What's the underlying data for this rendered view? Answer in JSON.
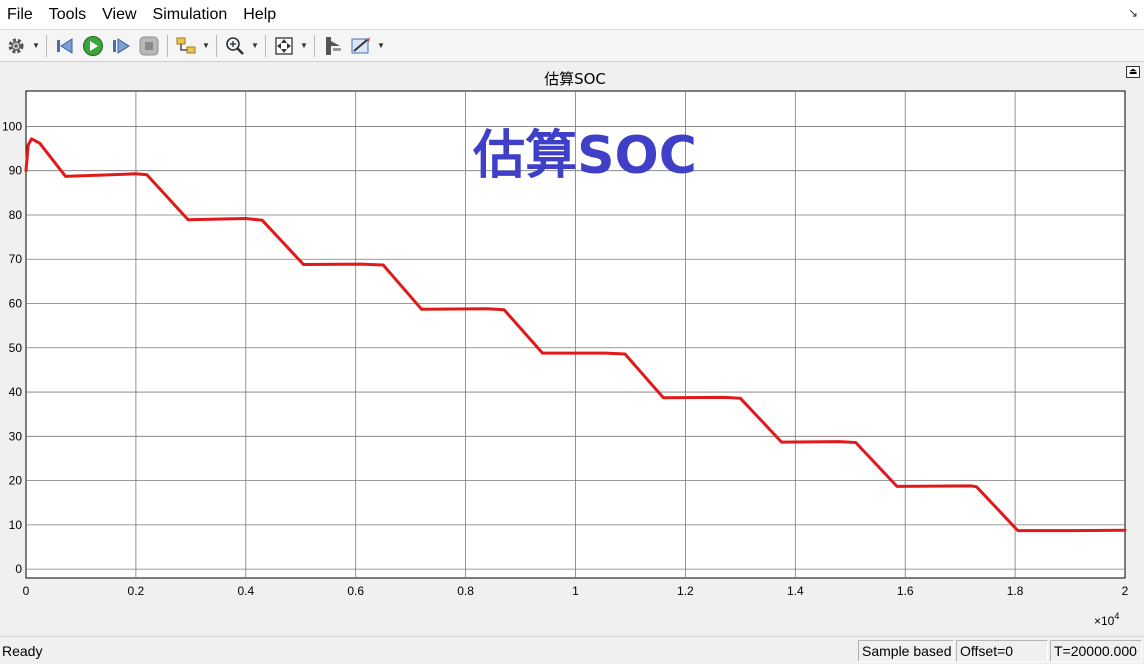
{
  "menu": {
    "items": [
      "File",
      "Tools",
      "View",
      "Simulation",
      "Help"
    ]
  },
  "toolbar": {
    "icons": [
      "gear-icon",
      "step-back-icon",
      "run-icon",
      "step-forward-icon",
      "stop-icon",
      "highlight-model-icon",
      "zoom-in-icon",
      "fit-to-view-icon",
      "cursor-measure-icon",
      "style-icon"
    ]
  },
  "plot": {
    "title": "估算SOC",
    "annotation": "估算SOC",
    "x_exponent_base": "×10",
    "x_exponent_power": "4",
    "line_color": "#e0191b",
    "annotation_color": "#3f3fc8"
  },
  "chart_data": {
    "type": "line",
    "title": "估算SOC",
    "xlabel": "",
    "ylabel": "",
    "xlim": [
      0,
      20000
    ],
    "ylim": [
      -2,
      108
    ],
    "grid": true,
    "x_ticks": [
      0,
      2000,
      4000,
      6000,
      8000,
      10000,
      12000,
      14000,
      16000,
      18000,
      20000
    ],
    "x_tick_labels": [
      "0",
      "0.2",
      "0.4",
      "0.6",
      "0.8",
      "1",
      "1.2",
      "1.4",
      "1.6",
      "1.8",
      "2"
    ],
    "y_ticks": [
      0,
      10,
      20,
      30,
      40,
      50,
      60,
      70,
      80,
      90,
      100
    ],
    "y_tick_labels": [
      "0",
      "10",
      "20",
      "30",
      "40",
      "50",
      "60",
      "70",
      "80",
      "90",
      "100"
    ],
    "series": [
      {
        "color": "#e0191b",
        "x": [
          0,
          40,
          100,
          250,
          720,
          2000,
          2200,
          2950,
          4000,
          4300,
          5050,
          6100,
          6500,
          7200,
          8400,
          8700,
          9400,
          10550,
          10900,
          11600,
          12700,
          13000,
          13750,
          14800,
          15100,
          15850,
          17200,
          17300,
          18050,
          19100,
          20000
        ],
        "y": [
          90,
          95.8,
          97.2,
          96.2,
          88.7,
          89.3,
          89.1,
          78.9,
          79.2,
          78.8,
          68.8,
          68.9,
          68.7,
          58.7,
          58.8,
          58.6,
          48.8,
          48.8,
          48.6,
          38.7,
          38.8,
          38.6,
          28.7,
          28.8,
          28.6,
          18.7,
          18.8,
          18.6,
          8.7,
          8.7,
          8.8
        ]
      }
    ]
  },
  "status": {
    "ready": "Ready",
    "mode": "Sample based",
    "offset": "Offset=0",
    "time": "T=20000.000"
  }
}
